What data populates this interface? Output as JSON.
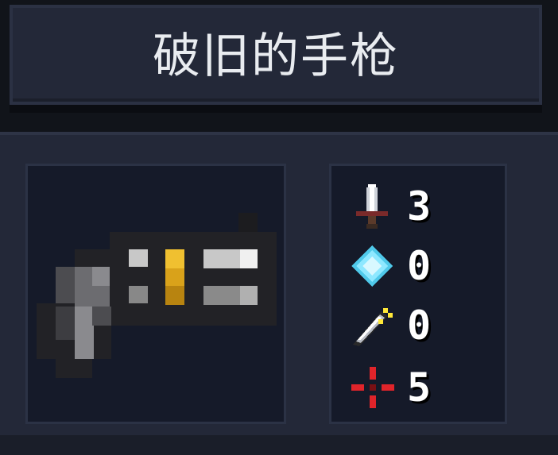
{
  "item": {
    "name": "破旧的手枪",
    "icon": "pistol-icon"
  },
  "stats": [
    {
      "key": "damage",
      "icon": "sword-icon",
      "value": "3"
    },
    {
      "key": "energy_cost",
      "icon": "crystal-icon",
      "value": "0"
    },
    {
      "key": "critical",
      "icon": "sharp-blade-icon",
      "value": "0"
    },
    {
      "key": "inaccuracy",
      "icon": "crosshair-icon",
      "value": "5"
    }
  ],
  "colors": {
    "panel": "#232838",
    "slot": "#151a29",
    "text": "#e9ecf0",
    "energy": "#8ee8ff",
    "crosshair": "#e0242a",
    "gold": "#d9a21a"
  }
}
